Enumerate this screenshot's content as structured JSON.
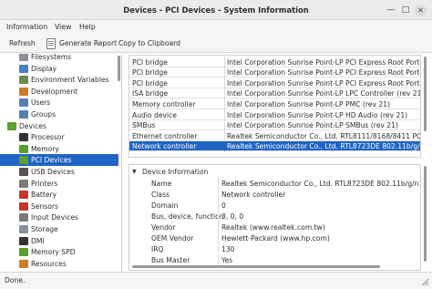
{
  "window": {
    "title": "Devices - PCI Devices - System Information"
  },
  "menu": [
    "Information",
    "View",
    "Help"
  ],
  "toolbar": {
    "refresh": "Refresh",
    "report": "Generate Report",
    "copy": "Copy to Clipboard"
  },
  "sidebar": [
    {
      "label": "Filesystems",
      "icon": "filesystems-icon",
      "color": "#8a8f99"
    },
    {
      "label": "Display",
      "icon": "display-icon",
      "color": "#4a7fc1"
    },
    {
      "label": "Environment Variables",
      "icon": "environment-icon",
      "color": "#6c8b4a"
    },
    {
      "label": "Development",
      "icon": "development-icon",
      "color": "#d07a2a"
    },
    {
      "label": "Users",
      "icon": "users-icon",
      "color": "#5a7fb5"
    },
    {
      "label": "Groups",
      "icon": "groups-icon",
      "color": "#5a7fb5"
    },
    {
      "label": "Devices",
      "icon": "devices-icon",
      "color": "#5aa02c",
      "level": 0
    },
    {
      "label": "Processor",
      "icon": "processor-icon",
      "color": "#333333"
    },
    {
      "label": "Memory",
      "icon": "memory-icon",
      "color": "#5aa02c"
    },
    {
      "label": "PCI Devices",
      "icon": "pci-icon",
      "color": "#5aa02c",
      "selected": true
    },
    {
      "label": "USB Devices",
      "icon": "usb-icon",
      "color": "#555555"
    },
    {
      "label": "Printers",
      "icon": "printer-icon",
      "color": "#7a7a7a"
    },
    {
      "label": "Battery",
      "icon": "battery-icon",
      "color": "#c0392b"
    },
    {
      "label": "Sensors",
      "icon": "sensors-icon",
      "color": "#c0392b"
    },
    {
      "label": "Input Devices",
      "icon": "input-icon",
      "color": "#7a7a7a"
    },
    {
      "label": "Storage",
      "icon": "storage-icon",
      "color": "#8a8f99"
    },
    {
      "label": "DMI",
      "icon": "dmi-icon",
      "color": "#333333"
    },
    {
      "label": "Memory SPD",
      "icon": "memory-spd-icon",
      "color": "#5aa02c"
    },
    {
      "label": "Resources",
      "icon": "resources-icon",
      "color": "#d07a2a"
    }
  ],
  "devices": [
    {
      "type": "PCI bridge",
      "name": "Intel Corporation Sunrise Point-LP PCI Express Root Port #1 ("
    },
    {
      "type": "PCI bridge",
      "name": "Intel Corporation Sunrise Point-LP PCI Express Root Port #6 ("
    },
    {
      "type": "PCI bridge",
      "name": "Intel Corporation Sunrise Point-LP PCI Express Root Port #9 ("
    },
    {
      "type": "ISA bridge",
      "name": "Intel Corporation Sunrise Point-LP LPC Controller (rev 21)"
    },
    {
      "type": "Memory controller",
      "name": "Intel Corporation Sunrise Point-LP PMC (rev 21)"
    },
    {
      "type": "Audio device",
      "name": "Intel Corporation Sunrise Point-LP HD Audio (rev 21)"
    },
    {
      "type": "SMBus",
      "name": "Intel Corporation Sunrise Point-LP SMBus (rev 21)"
    },
    {
      "type": "Ethernet controller",
      "name": "Realtek Semiconductor Co., Ltd. RTL8111/8168/8411 PCI Expre"
    },
    {
      "type": "Network controller",
      "name": "Realtek Semiconductor Co., Ltd. RTL8723DE 802.11b/g/n PCIe",
      "selected": true
    }
  ],
  "details": {
    "group": "Device Information",
    "rows": [
      {
        "key": "Name",
        "value": "Realtek Semiconductor Co., Ltd. RTL8723DE 802.11b/g/n PCIe"
      },
      {
        "key": "Class",
        "value": "Network controller"
      },
      {
        "key": "Domain",
        "value": "0"
      },
      {
        "key": "Bus, device, function",
        "value": "3, 0, 0"
      },
      {
        "key": "Vendor",
        "value": "Realtek (www.realtek.com.tw)"
      },
      {
        "key": "OEM Vendor",
        "value": "Hewlett-Packard (www.hp.com)"
      },
      {
        "key": "IRQ",
        "value": "130"
      },
      {
        "key": "Bus Master",
        "value": "Yes"
      }
    ]
  },
  "status": "Done.",
  "colors": {
    "selection": "#1e65c6",
    "chrome": "#f6f5f4",
    "titlebar": "#ebebeb"
  }
}
